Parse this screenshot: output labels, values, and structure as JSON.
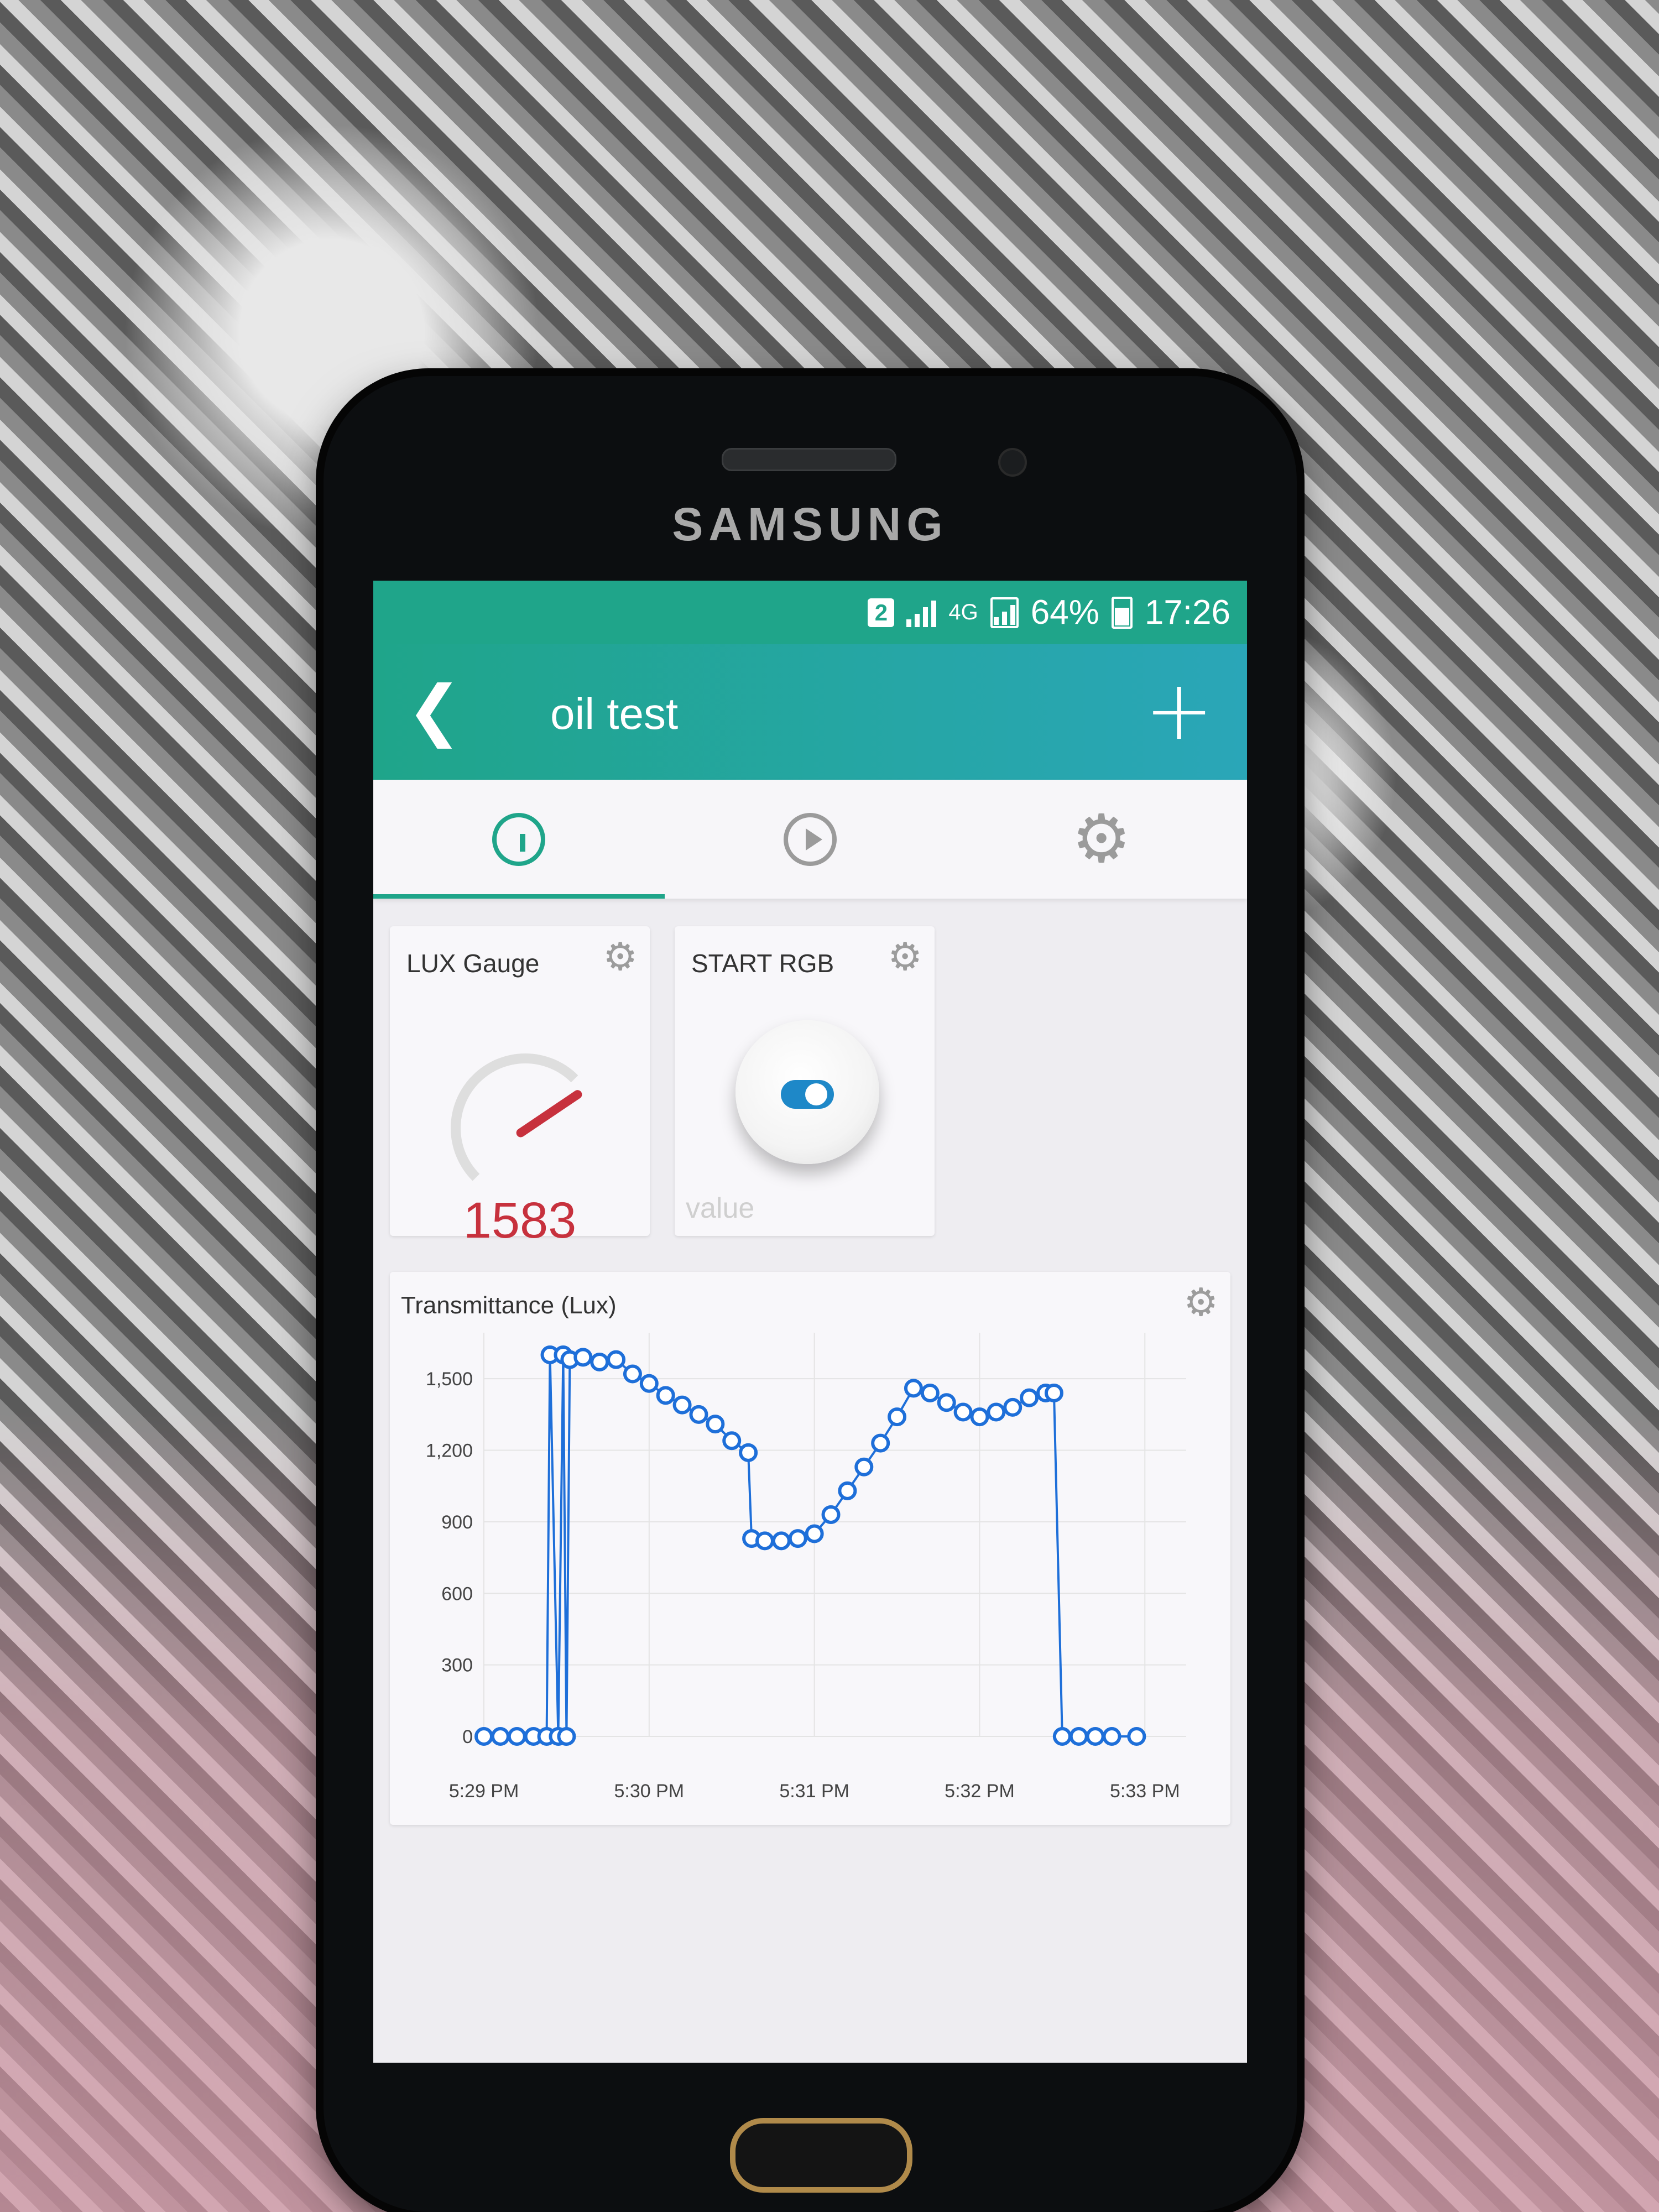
{
  "device": {
    "brand": "SAMSUNG"
  },
  "status_bar": {
    "sim": "2",
    "network": "4G",
    "battery": "64%",
    "time": "17:26"
  },
  "app_bar": {
    "title": "oil test",
    "back_icon": "chevron-left-icon",
    "add_icon": "plus-icon"
  },
  "tabs": [
    {
      "icon": "dashboard-gauge-icon",
      "active": true
    },
    {
      "icon": "play-icon",
      "active": false
    },
    {
      "icon": "gear-icon",
      "active": false
    }
  ],
  "widgets": {
    "gauge": {
      "label": "LUX Gauge",
      "value": "1583",
      "fraction": 0.8
    },
    "button": {
      "label": "START RGB",
      "footer": "value",
      "state": "on"
    }
  },
  "colors": {
    "accent": "#1fa58a",
    "series": "#1e6fd9",
    "gauge_value": "#c7313d"
  },
  "chart_data": {
    "type": "line",
    "title": "Transmittance (Lux)",
    "xlabel": "",
    "ylabel": "",
    "x_ticks": [
      "5:29 PM",
      "5:30 PM",
      "5:31 PM",
      "5:32 PM",
      "5:33 PM"
    ],
    "y_ticks": [
      "0",
      "300",
      "600",
      "900",
      "1,200",
      "1,500"
    ],
    "ylim": [
      0,
      1600
    ],
    "xlim": [
      0,
      4.25
    ],
    "grid": true,
    "series": [
      {
        "markers": "open-circle",
        "points": [
          [
            0.0,
            0
          ],
          [
            0.1,
            0
          ],
          [
            0.2,
            0
          ],
          [
            0.3,
            0
          ],
          [
            0.38,
            0
          ],
          [
            0.4,
            1600
          ],
          [
            0.45,
            0
          ],
          [
            0.48,
            1600
          ],
          [
            0.5,
            0
          ],
          [
            0.52,
            1580
          ],
          [
            0.6,
            1590
          ],
          [
            0.7,
            1570
          ],
          [
            0.8,
            1580
          ],
          [
            0.9,
            1520
          ],
          [
            1.0,
            1480
          ],
          [
            1.1,
            1430
          ],
          [
            1.2,
            1390
          ],
          [
            1.3,
            1350
          ],
          [
            1.4,
            1310
          ],
          [
            1.5,
            1240
          ],
          [
            1.6,
            1190
          ],
          [
            1.62,
            830
          ],
          [
            1.7,
            820
          ],
          [
            1.8,
            820
          ],
          [
            1.9,
            830
          ],
          [
            2.0,
            850
          ],
          [
            2.1,
            930
          ],
          [
            2.2,
            1030
          ],
          [
            2.3,
            1130
          ],
          [
            2.4,
            1230
          ],
          [
            2.5,
            1340
          ],
          [
            2.6,
            1460
          ],
          [
            2.7,
            1440
          ],
          [
            2.8,
            1400
          ],
          [
            2.9,
            1360
          ],
          [
            3.0,
            1340
          ],
          [
            3.1,
            1360
          ],
          [
            3.2,
            1380
          ],
          [
            3.3,
            1420
          ],
          [
            3.4,
            1440
          ],
          [
            3.45,
            1440
          ],
          [
            3.5,
            0
          ],
          [
            3.6,
            0
          ],
          [
            3.7,
            0
          ],
          [
            3.8,
            0
          ],
          [
            3.95,
            0
          ]
        ]
      }
    ]
  }
}
